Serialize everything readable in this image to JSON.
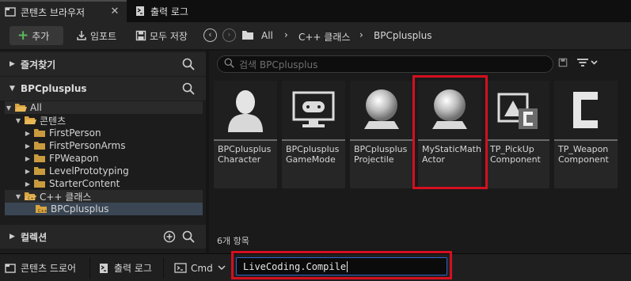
{
  "tabs": [
    {
      "label": "콘텐츠 브라우저",
      "icon": "content-browser-icon"
    },
    {
      "label": "출력 로그",
      "icon": "output-log-icon"
    }
  ],
  "toolbar": {
    "add_label": "추가",
    "import_label": "임포트",
    "save_all_label": "모두 저장",
    "breadcrumb": [
      "All",
      "C++ 클래스",
      "BPCplusplus"
    ]
  },
  "left": {
    "favorites_label": "즐겨찾기",
    "project_label": "BPCplusplus",
    "collections_label": "컬렉션",
    "tree": [
      {
        "label": "All"
      },
      {
        "label": "콘텐츠"
      },
      {
        "label": "FirstPerson"
      },
      {
        "label": "FirstPersonArms"
      },
      {
        "label": "FPWeapon"
      },
      {
        "label": "LevelPrototyping"
      },
      {
        "label": "StarterContent"
      },
      {
        "label": "C++ 클래스"
      },
      {
        "label": "BPCplusplus"
      }
    ]
  },
  "right": {
    "search_placeholder": "검색 BPCplusplus",
    "items": [
      {
        "line1": "BPCplusplus",
        "line2": "Character"
      },
      {
        "line1": "BPCplusplus",
        "line2": "GameMode"
      },
      {
        "line1": "BPCplusplus",
        "line2": "Projectile"
      },
      {
        "line1": "MyStaticMath",
        "line2": "Actor"
      },
      {
        "line1": "TP_PickUp",
        "line2": "Component"
      },
      {
        "line1": "TP_Weapon",
        "line2": "Component"
      }
    ],
    "count_label": "6개 항목"
  },
  "bottom": {
    "content_drawer_label": "콘텐츠 드로어",
    "output_log_label": "출력 로그",
    "cmd_label": "Cmd",
    "console_value": "LiveCoding.Compile"
  },
  "colors": {
    "highlight": "#d40f1f",
    "add_plus": "#5cb85c",
    "focus_border": "#2e66c8"
  }
}
